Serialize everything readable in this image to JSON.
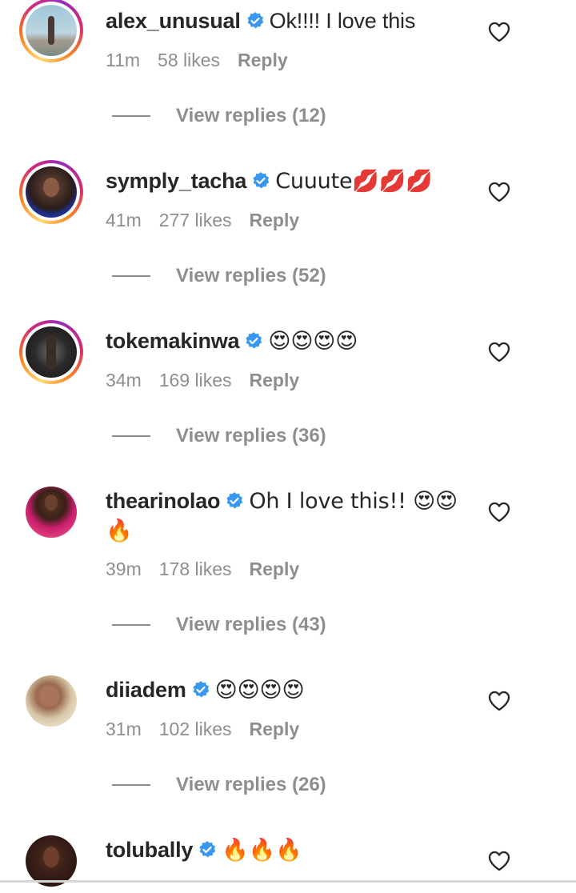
{
  "comments": [
    {
      "username": "alex_unusual",
      "text": "Ok!!!! I love this",
      "time": "11m",
      "likes": "58 likes",
      "reply": "Reply",
      "view_replies": "View replies (12)",
      "story_ring": true
    },
    {
      "username": "symply_tacha",
      "text": "Cuuute💋💋💋",
      "time": "41m",
      "likes": "277 likes",
      "reply": "Reply",
      "view_replies": "View replies (52)",
      "story_ring": true
    },
    {
      "username": "tokemakinwa",
      "text": "😍😍😍😍",
      "time": "34m",
      "likes": "169 likes",
      "reply": "Reply",
      "view_replies": "View replies (36)",
      "story_ring": true
    },
    {
      "username": "thearinolao",
      "text": "Oh I love this!! 😍😍",
      "text2": "🔥",
      "time": "39m",
      "likes": "178 likes",
      "reply": "Reply",
      "view_replies": "View replies (43)",
      "story_ring": false
    },
    {
      "username": "diiadem",
      "text": "😍😍😍😍",
      "time": "31m",
      "likes": "102 likes",
      "reply": "Reply",
      "view_replies": "View replies (26)",
      "story_ring": false
    },
    {
      "username": "tolubally",
      "text": "🔥🔥🔥",
      "story_ring": false
    }
  ],
  "colors": {
    "verified": "#3897f0",
    "secondary_text": "#8e8e8e",
    "primary_text": "#262626"
  },
  "icons": {
    "verified": "verified-badge-icon",
    "like": "heart-outline-icon"
  }
}
